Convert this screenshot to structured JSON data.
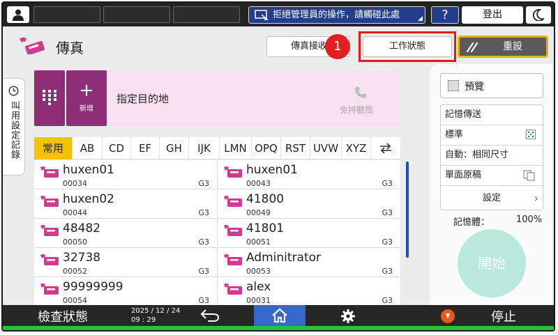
{
  "topbar": {
    "notice": "拒絕管理員的操作，請觸碰此處",
    "help": "?",
    "logout": "登出"
  },
  "header": {
    "title": "傳真",
    "fax_receive": "傳真接收",
    "badge": "1",
    "job_status": "工作狀態",
    "reset": "重設"
  },
  "side_tab": {
    "label": "叫用設定記錄"
  },
  "destination": {
    "add_label": "新增",
    "placeholder": "指定目的地",
    "handsfree": "免持聽筒"
  },
  "tabs": [
    "常用",
    "AB",
    "CD",
    "EF",
    "GH",
    "IJK",
    "LMN",
    "OPQ",
    "RST",
    "UVW",
    "XYZ"
  ],
  "entries": [
    {
      "name": "huxen01",
      "num": "00034",
      "g": "G3"
    },
    {
      "name": "huxen01",
      "num": "00043",
      "g": "G3"
    },
    {
      "name": "huxen02",
      "num": "00044",
      "g": "G3"
    },
    {
      "name": "41800",
      "num": "00049",
      "g": "G3"
    },
    {
      "name": "48482",
      "num": "00050",
      "g": "G3"
    },
    {
      "name": "41801",
      "num": "00051",
      "g": "G3"
    },
    {
      "name": "32738",
      "num": "00052",
      "g": "G3"
    },
    {
      "name": "Adminitrator",
      "num": "00053",
      "g": "G3"
    },
    {
      "name": "99999999",
      "num": "00054",
      "g": "G3"
    },
    {
      "name": "alex",
      "num": "00031",
      "g": "G3"
    }
  ],
  "right_panel": {
    "preview": "預覽",
    "memory_tx": "記憶傳送",
    "quality": "標準",
    "size": "自動：相同尺寸",
    "original": "單面原稿",
    "settings": "設定",
    "memory_label": "記憶體：",
    "memory_value": "100%",
    "start": "開始"
  },
  "bottombar": {
    "check_status": "檢查狀態",
    "date": "2025 / 12 / 24",
    "time": "09 : 29",
    "stop": "停止"
  },
  "colors": {
    "accent_purple": "#8c2d76",
    "dest_bg": "#f9e1f2",
    "tab_active": "#f3c200",
    "highlight": "#e01b1b",
    "start": "#b9e9dc"
  }
}
